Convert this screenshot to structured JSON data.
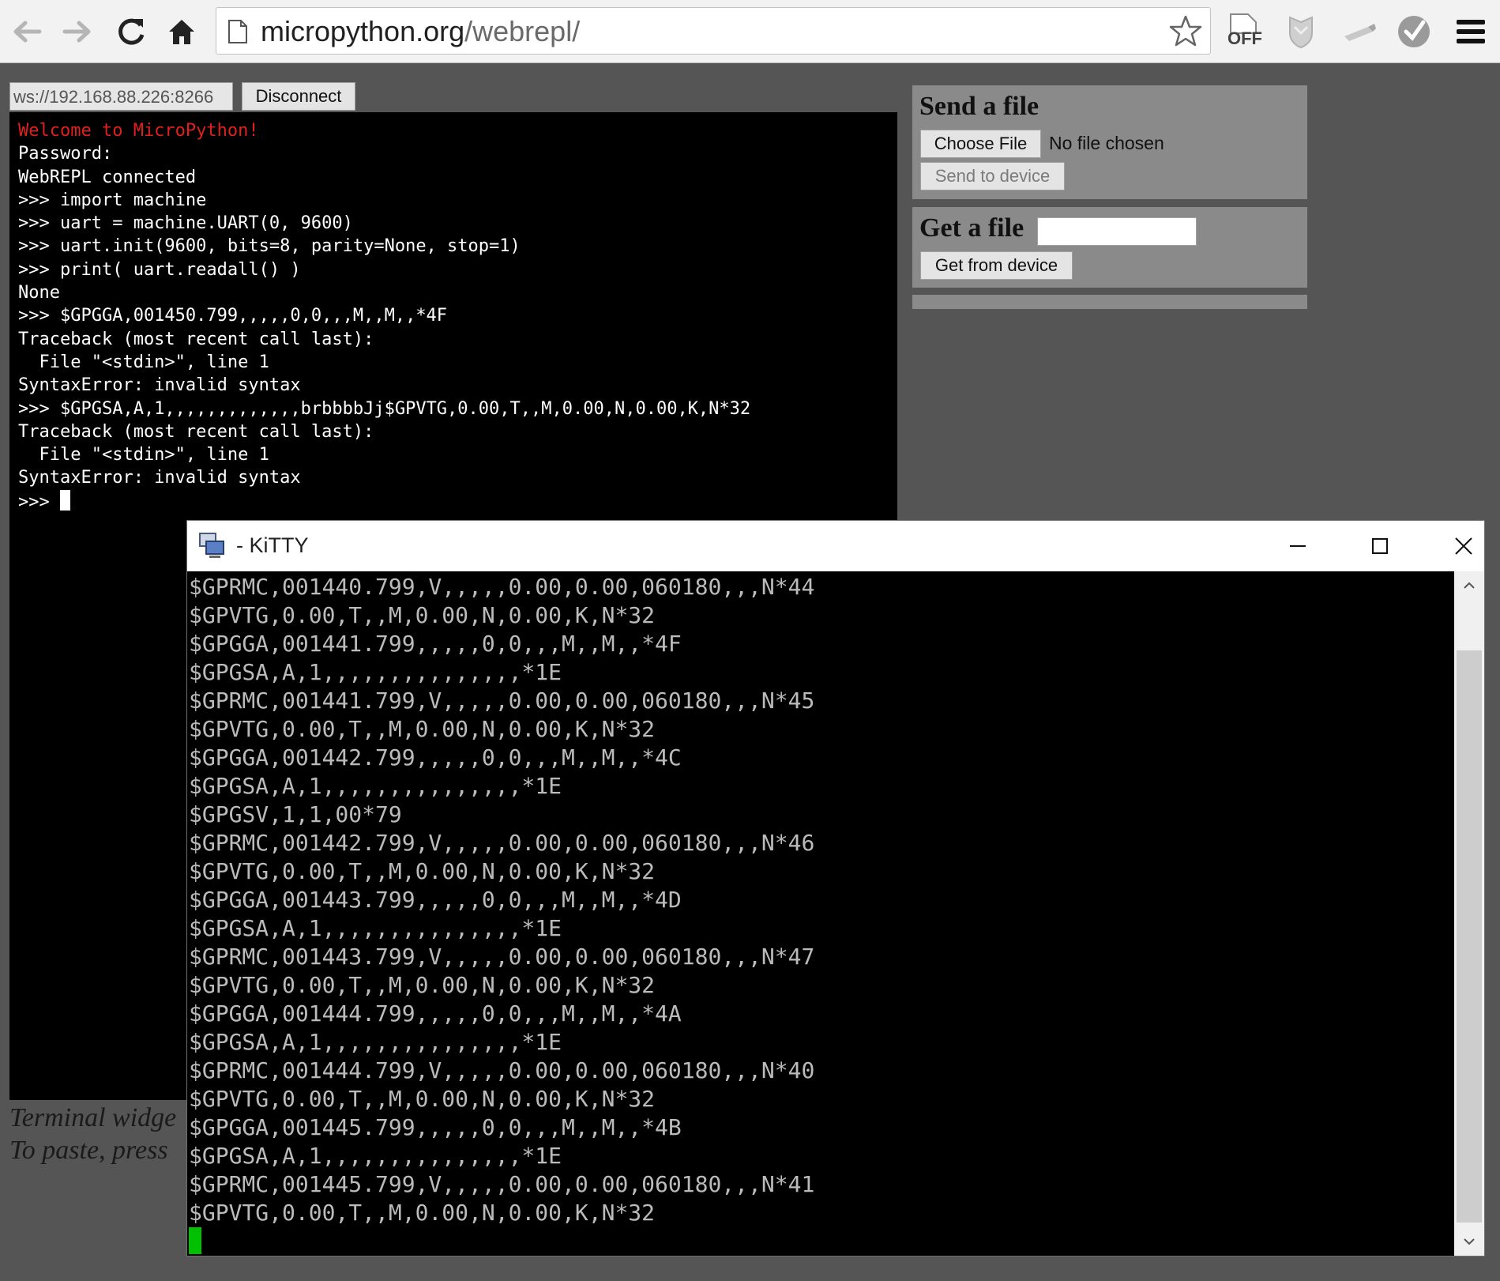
{
  "browser": {
    "url_host": "micropython.org",
    "url_path": "/webrepl/",
    "ext_off_label": "OFF"
  },
  "webrepl": {
    "ws_url": "ws://192.168.88.226:8266",
    "disconnect_label": "Disconnect",
    "welcome": "Welcome to MicroPython!",
    "lines": [
      "Password:",
      "WebREPL connected",
      ">>> import machine",
      ">>> uart = machine.UART(0, 9600)",
      ">>> uart.init(9600, bits=8, parity=None, stop=1)",
      ">>> print( uart.readall() )",
      "None",
      ">>> $GPGGA,001450.799,,,,,0,0,,,M,,M,,*4F",
      "Traceback (most recent call last):",
      "  File \"<stdin>\", line 1",
      "SyntaxError: invalid syntax",
      ">>> $GPGSA,A,1,,,,,,,,,,,,,brbbbbJj$GPVTG,0.00,T,,M,0.00,N,0.00,K,N*32",
      "Traceback (most recent call last):",
      "  File \"<stdin>\", line 1",
      "SyntaxError: invalid syntax"
    ],
    "prompt": ">>> ",
    "footer_line1": "Terminal widge",
    "footer_line2": "To paste, press"
  },
  "send_file": {
    "title": "Send a file",
    "choose_label": "Choose File",
    "no_file": "No file chosen",
    "send_label": "Send to device"
  },
  "get_file": {
    "title": "Get a file",
    "input_value": "",
    "get_label": "Get from device"
  },
  "kitty": {
    "title": "- KiTTY",
    "lines": [
      "$GPRMC,001440.799,V,,,,,0.00,0.00,060180,,,N*44",
      "$GPVTG,0.00,T,,M,0.00,N,0.00,K,N*32",
      "$GPGGA,001441.799,,,,,0,0,,,M,,M,,*4F",
      "$GPGSA,A,1,,,,,,,,,,,,,,,*1E",
      "$GPRMC,001441.799,V,,,,,0.00,0.00,060180,,,N*45",
      "$GPVTG,0.00,T,,M,0.00,N,0.00,K,N*32",
      "$GPGGA,001442.799,,,,,0,0,,,M,,M,,*4C",
      "$GPGSA,A,1,,,,,,,,,,,,,,,*1E",
      "$GPGSV,1,1,00*79",
      "$GPRMC,001442.799,V,,,,,0.00,0.00,060180,,,N*46",
      "$GPVTG,0.00,T,,M,0.00,N,0.00,K,N*32",
      "$GPGGA,001443.799,,,,,0,0,,,M,,M,,*4D",
      "$GPGSA,A,1,,,,,,,,,,,,,,,*1E",
      "$GPRMC,001443.799,V,,,,,0.00,0.00,060180,,,N*47",
      "$GPVTG,0.00,T,,M,0.00,N,0.00,K,N*32",
      "$GPGGA,001444.799,,,,,0,0,,,M,,M,,*4A",
      "$GPGSA,A,1,,,,,,,,,,,,,,,*1E",
      "$GPRMC,001444.799,V,,,,,0.00,0.00,060180,,,N*40",
      "$GPVTG,0.00,T,,M,0.00,N,0.00,K,N*32",
      "$GPGGA,001445.799,,,,,0,0,,,M,,M,,*4B",
      "$GPGSA,A,1,,,,,,,,,,,,,,,*1E",
      "$GPRMC,001445.799,V,,,,,0.00,0.00,060180,,,N*41",
      "$GPVTG,0.00,T,,M,0.00,N,0.00,K,N*32"
    ]
  },
  "icons": {
    "back": "back-arrow-icon",
    "forward": "forward-arrow-icon",
    "reload": "reload-icon",
    "home": "home-icon",
    "page": "page-icon",
    "bookmark": "star-icon",
    "ext1": "off-extension-icon",
    "ext2": "shield-extension-icon",
    "ext3": "usb-extension-icon",
    "ext4": "check-circle-extension-icon",
    "menu": "hamburger-menu-icon",
    "kitty_app": "kitty-computer-icon",
    "minimize": "minimize-icon",
    "maximize": "maximize-icon",
    "close": "close-icon",
    "scroll_up": "chevron-up-icon",
    "scroll_down": "chevron-down-icon"
  },
  "colors": {
    "page_bg": "#555555",
    "repl_bg": "#000000",
    "welcome_red": "#e0201c",
    "panel_bg": "#8a8a8a",
    "kitty_text": "#bbbbbb",
    "kitty_cursor": "#00c000"
  }
}
